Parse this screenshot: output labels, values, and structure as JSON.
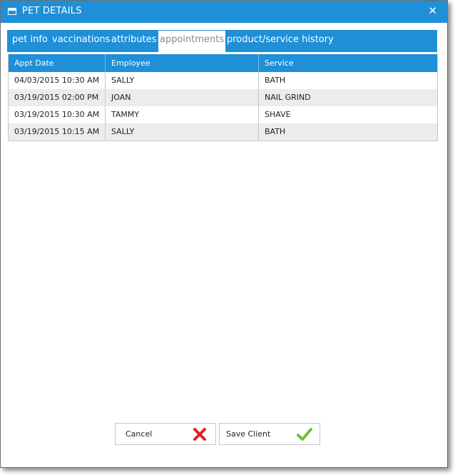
{
  "window": {
    "title": "PET DETAILS",
    "close_glyph": "✕"
  },
  "tabs": [
    {
      "label": "pet info",
      "active": false
    },
    {
      "label": "vaccinations",
      "active": false
    },
    {
      "label": "attributes",
      "active": false
    },
    {
      "label": "appointments",
      "active": true
    },
    {
      "label": "product/service history",
      "active": false
    }
  ],
  "grid": {
    "columns": [
      "Appt Date",
      "Employee",
      "Service"
    ],
    "rows": [
      [
        "04/03/2015 10:30 AM",
        "SALLY",
        "BATH"
      ],
      [
        "03/19/2015 02:00 PM",
        "JOAN",
        "NAIL GRIND"
      ],
      [
        "03/19/2015 10:30 AM",
        "TAMMY",
        "SHAVE"
      ],
      [
        "03/19/2015 10:15 AM",
        "SALLY",
        "BATH"
      ]
    ]
  },
  "buttons": {
    "cancel_label": "Cancel",
    "save_label": "Save Client"
  },
  "colors": {
    "accent": "#1f8fd8",
    "cancel_icon": "#e02020",
    "save_icon": "#6cc22a"
  },
  "icons": {
    "title": "window-icon",
    "close": "close-icon",
    "cancel": "red-x-icon",
    "save": "green-check-icon"
  }
}
